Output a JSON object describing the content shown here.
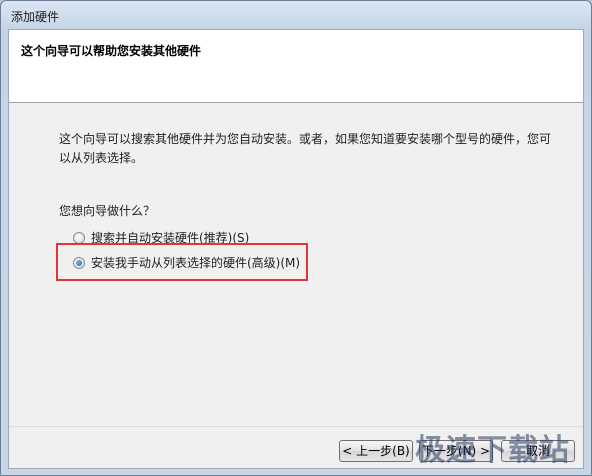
{
  "window": {
    "title": "添加硬件"
  },
  "header": {
    "title": "这个向导可以帮助您安装其他硬件"
  },
  "body": {
    "description": "这个向导可以搜索其他硬件并为您自动安装。或者，如果您知道要安装哪个型号的硬件，您可以从列表选择。",
    "question": "您想向导做什么？",
    "options": [
      {
        "label": "搜索并自动安装硬件(推荐)(S)",
        "checked": false
      },
      {
        "label": "安装我手动从列表选择的硬件(高级)(M)",
        "checked": true
      }
    ]
  },
  "footer": {
    "back_label": "< 上一步(B)",
    "next_label": "下一步(N) >",
    "cancel_label": "取消"
  },
  "watermark": {
    "text": "极速下载站"
  },
  "colors": {
    "highlight": "#e2343a",
    "radio_checked": "#1c5fb8"
  }
}
